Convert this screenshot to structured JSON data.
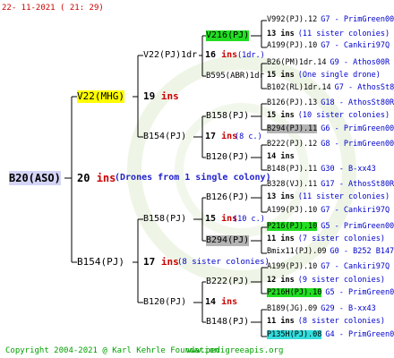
{
  "header": {
    "timestamp": "22- 11-2021 ( 21: 29)"
  },
  "footer": {
    "copyright": "Copyright 2004-2021 @ Karl Kehrle Foundation",
    "site": "www.pedigreeapis.org"
  },
  "root": {
    "name": "B20(ASO)",
    "ins": "20",
    "ins_label": "ins",
    "note": "(Drones from 1 single colony)"
  },
  "gen1": [
    {
      "name": "V22(MHG)",
      "ins": "19",
      "ins_label": "ins",
      "note": ""
    },
    {
      "name": "B154(PJ)",
      "ins": "17",
      "ins_label": "ins",
      "note": "(8 sister colonies)"
    }
  ],
  "gen2": [
    {
      "name": "V22(PJ)1dr",
      "ins": "16",
      "ins_label": "ins",
      "note": "(1dr.)"
    },
    {
      "name": "B154(PJ)",
      "ins": "17",
      "ins_label": "ins",
      "note": "(8 c.)"
    },
    {
      "name": "B158(PJ)",
      "ins": "15",
      "ins_label": "ins",
      "note": "(10 c.)"
    },
    {
      "name": "B120(PJ)",
      "ins": "14",
      "ins_label": "ins",
      "note": ""
    }
  ],
  "gen3": [
    {
      "name": "V216(PJ)",
      "ins": "13",
      "ins_label": "ins",
      "note": ""
    },
    {
      "name": "B595(ABR)1dr",
      "ins": "",
      "ins_label": "",
      "note": ""
    },
    {
      "name": "B158(PJ)",
      "ins": "15",
      "ins_label": "ins",
      "note": "(10 sister colonies)"
    },
    {
      "name": "B120(PJ)",
      "ins": "14",
      "ins_label": "ins",
      "note": ""
    },
    {
      "name": "B126(PJ)",
      "ins": "",
      "ins_label": "",
      "note": ""
    },
    {
      "name": "B294(PJ)",
      "ins": "",
      "ins_label": "",
      "note": ""
    },
    {
      "name": "B222(PJ)",
      "ins": "",
      "ins_label": "",
      "note": ""
    },
    {
      "name": "B148(PJ)",
      "ins": "",
      "ins_label": "",
      "note": ""
    }
  ],
  "gen4": [
    {
      "name": "V992(PJ).12",
      "code": "G7 - PrimGreen00"
    },
    {
      "name": "13 ins",
      "code": "(11 sister colonies)"
    },
    {
      "name": "A199(PJ).10",
      "code": "G7 - Cankiri97Q"
    },
    {
      "name": "B26(PM)1dr.14",
      "code": "G9 - Athos00R"
    },
    {
      "name": "15 ins",
      "code": "(One single drone)"
    },
    {
      "name": "B102(RL)1dr.14",
      "code": "G7 - AthosSt80R"
    },
    {
      "name": "B126(PJ).13",
      "code": "G18 - AthosSt80R"
    },
    {
      "name": "15 ins",
      "code": "(10 sister colonies)"
    },
    {
      "name": "B294(PJ).11",
      "code": "G6 - PrimGreen00"
    },
    {
      "name": "B222(PJ).12",
      "code": "G8 - PrimGreen00"
    },
    {
      "name": "14 ins",
      "code": ""
    },
    {
      "name": "B148(PJ).11",
      "code": "G30 - B-xx43"
    },
    {
      "name": "B328(VJ).11",
      "code": "G17 - AthosSt80R"
    },
    {
      "name": "13 ins",
      "code": "(11 sister colonies)"
    },
    {
      "name": "A199(PJ).10",
      "code": "G7 - Cankiri97Q"
    },
    {
      "name": "P216(PJ).10",
      "code": "G5 - PrimGreen00"
    },
    {
      "name": "11 ins",
      "code": "(7 sister colonies)"
    },
    {
      "name": "Bmix11(PJ).09",
      "code": "G0 - B252 B147 B"
    },
    {
      "name": "A199(PJ).10",
      "code": "G7 - Cankiri97Q"
    },
    {
      "name": "12 ins",
      "code": "(9 sister colonies)"
    },
    {
      "name": "P216H(PJ).10",
      "code": "G5 - PrimGreen00"
    },
    {
      "name": "B189(JG).09",
      "code": "G29 - B-xx43"
    },
    {
      "name": "11 ins",
      "code": "(8 sister colonies)"
    },
    {
      "name": "P135H(PJ).08",
      "code": "G4 - PrimGreen00"
    }
  ],
  "colors": {
    "red": "#cc0000",
    "blue": "#0000cc",
    "yellow": "#ffff00",
    "green": "#22dd22",
    "gray": "#b4b4b4",
    "cyan": "#33dddd",
    "footer": "#00a000"
  }
}
